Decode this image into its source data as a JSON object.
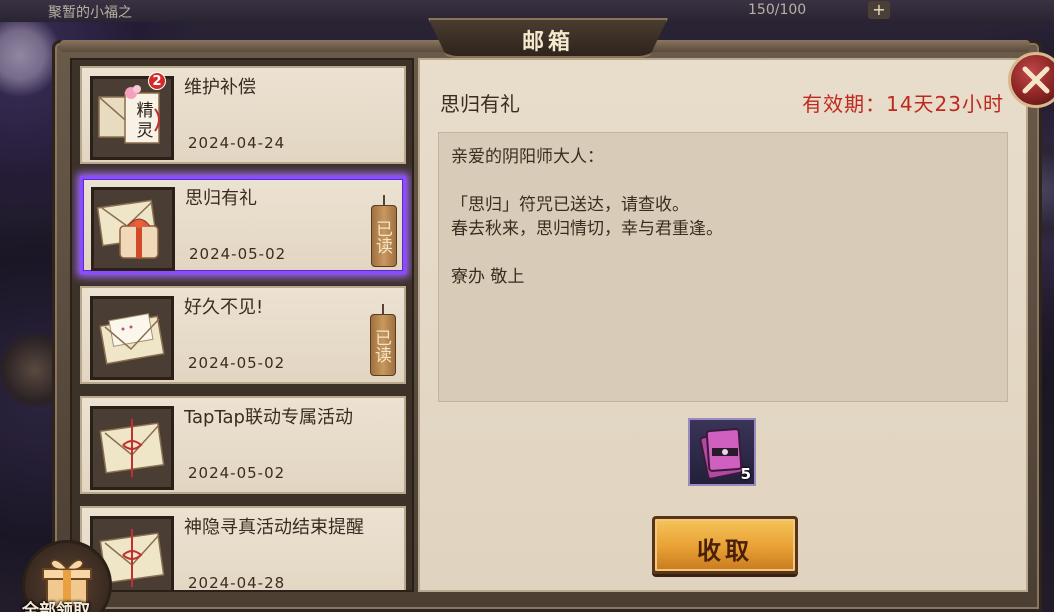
{
  "hud": {
    "left_text": "聚暂的小福之",
    "energy": "150/100",
    "plus": "+"
  },
  "mailbox": {
    "title": "邮箱"
  },
  "mails": [
    {
      "title": "维护补偿",
      "date": "2024-04-24",
      "badge": "2",
      "thumb_text": "精灵",
      "read": false,
      "read_label": "",
      "icon": "envelope-with-card-icon"
    },
    {
      "title": "思归有礼",
      "date": "2024-05-02",
      "read": true,
      "read_label": "已读",
      "icon": "envelope-gift-icon",
      "selected": true
    },
    {
      "title": "好久不见!",
      "date": "2024-05-02",
      "read": true,
      "read_label": "已读",
      "icon": "open-envelope-icon"
    },
    {
      "title": "TapTap联动专属活动",
      "date": "2024-05-02",
      "read": false,
      "read_label": "",
      "icon": "ribbon-envelope-icon"
    },
    {
      "title": "神隐寻真活动结束提醒",
      "date": "2024-04-28",
      "read": false,
      "read_label": "",
      "icon": "ribbon-envelope-icon"
    }
  ],
  "claim_all": {
    "label": "全部领取"
  },
  "detail": {
    "title": "思归有礼",
    "validity": "有效期：14天23小时",
    "body": [
      "亲爱的阴阳师大人：",
      "",
      "「思归」符咒已送达，请查收。",
      "春去秋来，思归情切，幸与君重逢。",
      "",
      "寮办 敬上"
    ],
    "reward": {
      "icon": "amulet-ticket-icon",
      "count": "5"
    },
    "claim_label": "收取"
  },
  "colors": {
    "selected_border": "#8a4cff",
    "validity": "#c0281e",
    "claim_button": "#e8a034"
  }
}
